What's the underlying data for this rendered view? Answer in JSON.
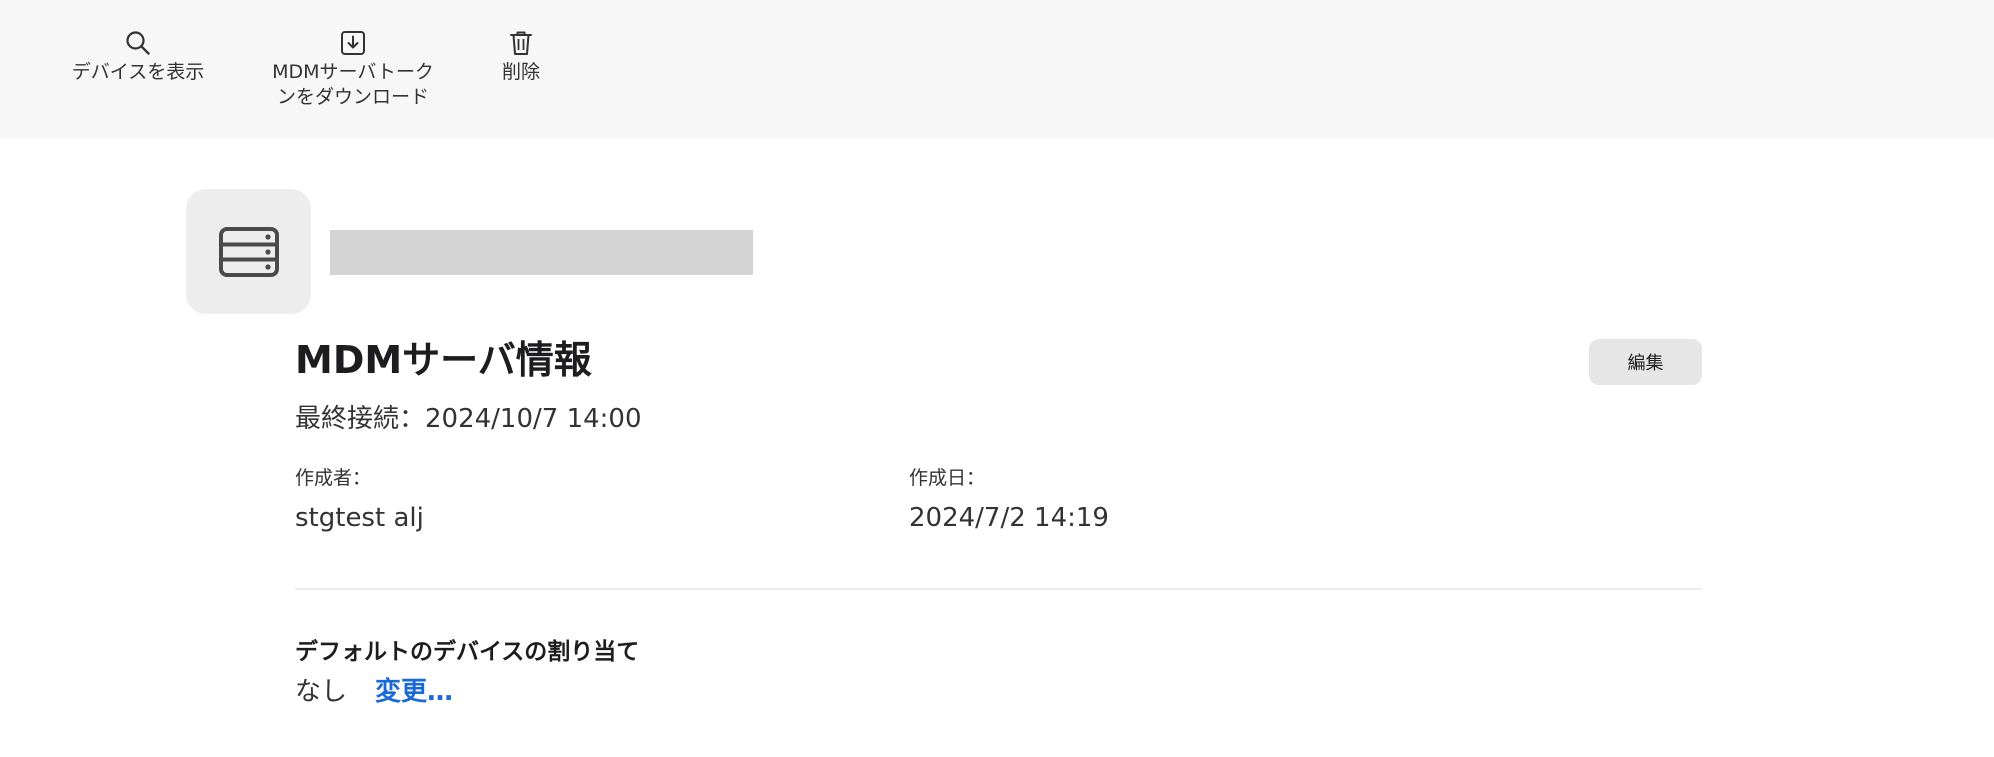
{
  "toolbar": {
    "items": [
      {
        "label": "デバイスを表示",
        "icon": "search-icon"
      },
      {
        "label_line1": "MDMサーバトーク",
        "label_line2": "ンをダウンロード",
        "icon": "download-icon"
      },
      {
        "label": "削除",
        "icon": "trash-icon"
      }
    ]
  },
  "server": {
    "icon": "server-icon"
  },
  "main": {
    "title": "MDMサーバ情報",
    "edit_label": "編集",
    "last_connection": "最終接続：2024/10/7 14:00",
    "created_by_label": "作成者：",
    "created_by_value": "stgtest alj",
    "created_date_label": "作成日：",
    "created_date_value": "2024/7/2 14:19"
  },
  "assignment": {
    "title": "デフォルトのデバイスの割り当て",
    "value": "なし",
    "change_label": "変更…"
  },
  "colors": {
    "toolbar_bg": "#f7f7f7",
    "link": "#1a6ad6",
    "button_bg": "#e6e6e6",
    "placeholder": "#d4d4d4"
  }
}
